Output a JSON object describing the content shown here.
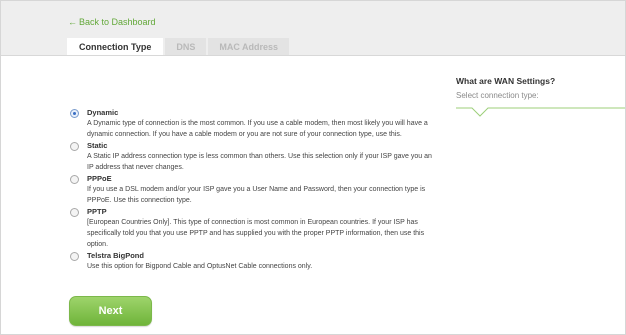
{
  "nav": {
    "back_label": "Back to Dashboard",
    "back_arrow": "←"
  },
  "tabs": [
    {
      "label": "Connection Type",
      "active": true
    },
    {
      "label": "DNS",
      "active": false
    },
    {
      "label": "MAC Address",
      "active": false
    }
  ],
  "side_panel": {
    "title": "What are WAN Settings?",
    "subtitle": "Select connection type:"
  },
  "options": [
    {
      "title": "Dynamic",
      "checked": true,
      "desc": "A Dynamic type of connection is the most common. If you use a cable modem, then most likely you will have a dynamic connection. If you have a cable modem or you are not sure of your connection type, use this."
    },
    {
      "title": "Static",
      "checked": false,
      "desc": "A Static IP address connection type is less common than others. Use this selection only if your ISP gave you an IP address that never changes."
    },
    {
      "title": "PPPoE",
      "checked": false,
      "desc": "If you use a DSL modem and/or your ISP gave you a User Name and Password, then your connection type is PPPoE. Use this connection type."
    },
    {
      "title": "PPTP",
      "checked": false,
      "desc": "[European Countries Only]. This type of connection is most common in European countries. If your ISP has specifically told you that you use PPTP and has supplied you with the proper PPTP information, then use this option."
    },
    {
      "title": "Telstra BigPond",
      "checked": false,
      "desc": "Use this option for Bigpond Cable and OptusNet Cable connections only."
    }
  ],
  "buttons": {
    "next_label": "Next"
  },
  "colors": {
    "accent_green": "#63a83a",
    "button_green": "#6fb43a",
    "header_gray": "#eeeeee"
  }
}
